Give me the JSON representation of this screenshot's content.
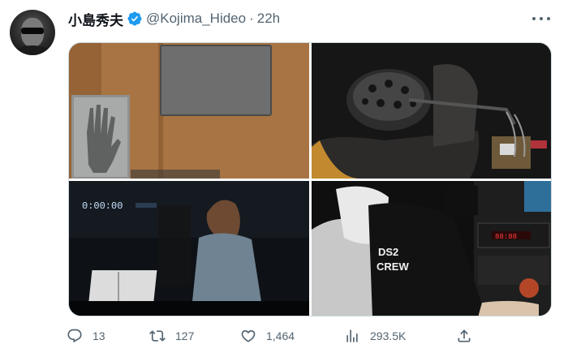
{
  "author": {
    "display_name": "小島秀夫",
    "handle": "@Kojima_Hideo",
    "separator": "·",
    "time": "22h",
    "verified": true
  },
  "media": {
    "image3_timecode": "0:00:00",
    "image4_shirt_text_line1": "DS2",
    "image4_shirt_text_line2": "CREW",
    "image4_display_text": "88:88"
  },
  "actions": {
    "replies": "13",
    "retweets": "127",
    "likes": "1,464",
    "views": "293.5K"
  },
  "colors": {
    "text_primary": "#0f1419",
    "text_secondary": "#536471",
    "verified_blue": "#1d9bf0"
  },
  "icons": [
    "verified-badge-icon",
    "more-icon",
    "reply-icon",
    "retweet-icon",
    "like-icon",
    "views-icon",
    "share-icon"
  ]
}
